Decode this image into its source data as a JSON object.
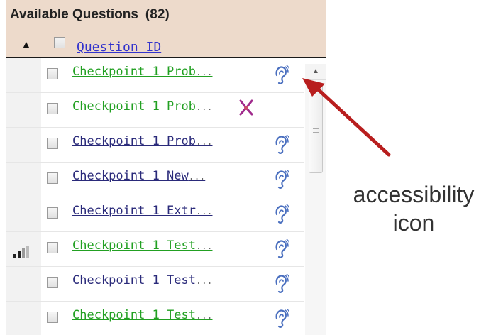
{
  "panel": {
    "title": "Available Questions",
    "count": "(82)",
    "sort_arrow": "▲",
    "column_header": "Question ID"
  },
  "rows": [
    {
      "label": "Checkpoint 1 Prob",
      "color": "green",
      "icon": "accessibility-icon",
      "signal": false
    },
    {
      "label": "Checkpoint 1 Prob",
      "color": "green",
      "icon": "pin-icon",
      "signal": false
    },
    {
      "label": "Checkpoint 1 Prob",
      "color": "navy",
      "icon": "accessibility-icon",
      "signal": false
    },
    {
      "label": "Checkpoint 1 New",
      "color": "navy",
      "icon": "accessibility-icon",
      "signal": false
    },
    {
      "label": "Checkpoint 1 Extr",
      "color": "navy",
      "icon": "accessibility-icon",
      "signal": false
    },
    {
      "label": "Checkpoint 1 Test",
      "color": "green",
      "icon": "accessibility-icon",
      "signal": true
    },
    {
      "label": "Checkpoint 1 Test",
      "color": "navy",
      "icon": "accessibility-icon",
      "signal": false
    },
    {
      "label": "Checkpoint 1 Test",
      "color": "green",
      "icon": "accessibility-icon",
      "signal": false
    }
  ],
  "ellipsis": "...",
  "annotation": {
    "line1": "accessibility",
    "line2": "icon"
  },
  "colors": {
    "header_bg": "#eddacb",
    "link_green": "#22a022",
    "link_navy": "#2a2a7a",
    "arrow_red": "#b81e1e"
  }
}
